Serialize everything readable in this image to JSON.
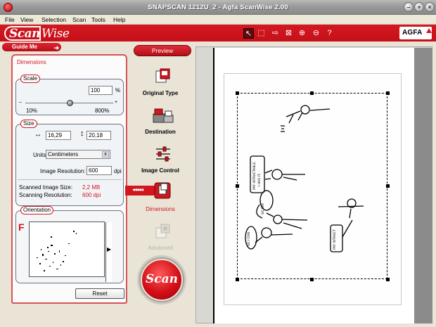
{
  "window": {
    "title": "SNAPSCAN 1212U_2 - Agfa ScanWise 2.00"
  },
  "menu": [
    "File",
    "View",
    "Selection",
    "Scan",
    "Tools",
    "Help"
  ],
  "toolbar": {
    "logo_scan": "Scan",
    "logo_wise": "Wise",
    "brand": "AGFA",
    "tools": [
      {
        "name": "pointer-tool",
        "icon": "cursor-icon",
        "glyph": "↖"
      },
      {
        "name": "marquee-tool",
        "icon": "marquee-icon",
        "glyph": "⬚"
      },
      {
        "name": "move-tool",
        "icon": "arrow-right-icon",
        "glyph": "⇨"
      },
      {
        "name": "crop-tool",
        "icon": "crop-icon",
        "glyph": "⊠"
      },
      {
        "name": "zoom-in-tool",
        "icon": "zoom-in-icon",
        "glyph": "⊕"
      },
      {
        "name": "zoom-out-tool",
        "icon": "zoom-out-icon",
        "glyph": "⊖"
      },
      {
        "name": "help-tool",
        "icon": "help-icon",
        "glyph": "?"
      }
    ]
  },
  "guide": {
    "label": "Guide Me"
  },
  "dimensions_panel": {
    "header": "Dimensions",
    "scale": {
      "label": "Scale",
      "value": "100",
      "unit": "%",
      "min": "10%",
      "max": "800%",
      "position": 0.51
    },
    "size": {
      "label": "Size",
      "width": "16,29",
      "height": "20,18",
      "units_label": "Units:",
      "units": "Centimeters",
      "resolution_label": "Image Resolution:",
      "resolution": "600",
      "resolution_unit": "dpi"
    },
    "scanned_size_label": "Scanned Image Size:",
    "scanned_size": "2,2 MB",
    "scanning_res_label": "Scanning Resolution:",
    "scanning_res": "600 dpi",
    "orientation": {
      "label": "Orientation",
      "letter": "F"
    },
    "reset": "Reset"
  },
  "nav": {
    "preview": "Preview",
    "items": [
      {
        "label": "Original Type",
        "icon": "original-type-icon"
      },
      {
        "label": "Destination",
        "icon": "destination-icon"
      },
      {
        "label": "Image Control",
        "icon": "image-control-icon"
      },
      {
        "label": "Dimensions",
        "icon": "dimensions-icon"
      },
      {
        "label": "Advanced",
        "icon": "advanced-icon"
      }
    ],
    "scan": "Scan"
  }
}
